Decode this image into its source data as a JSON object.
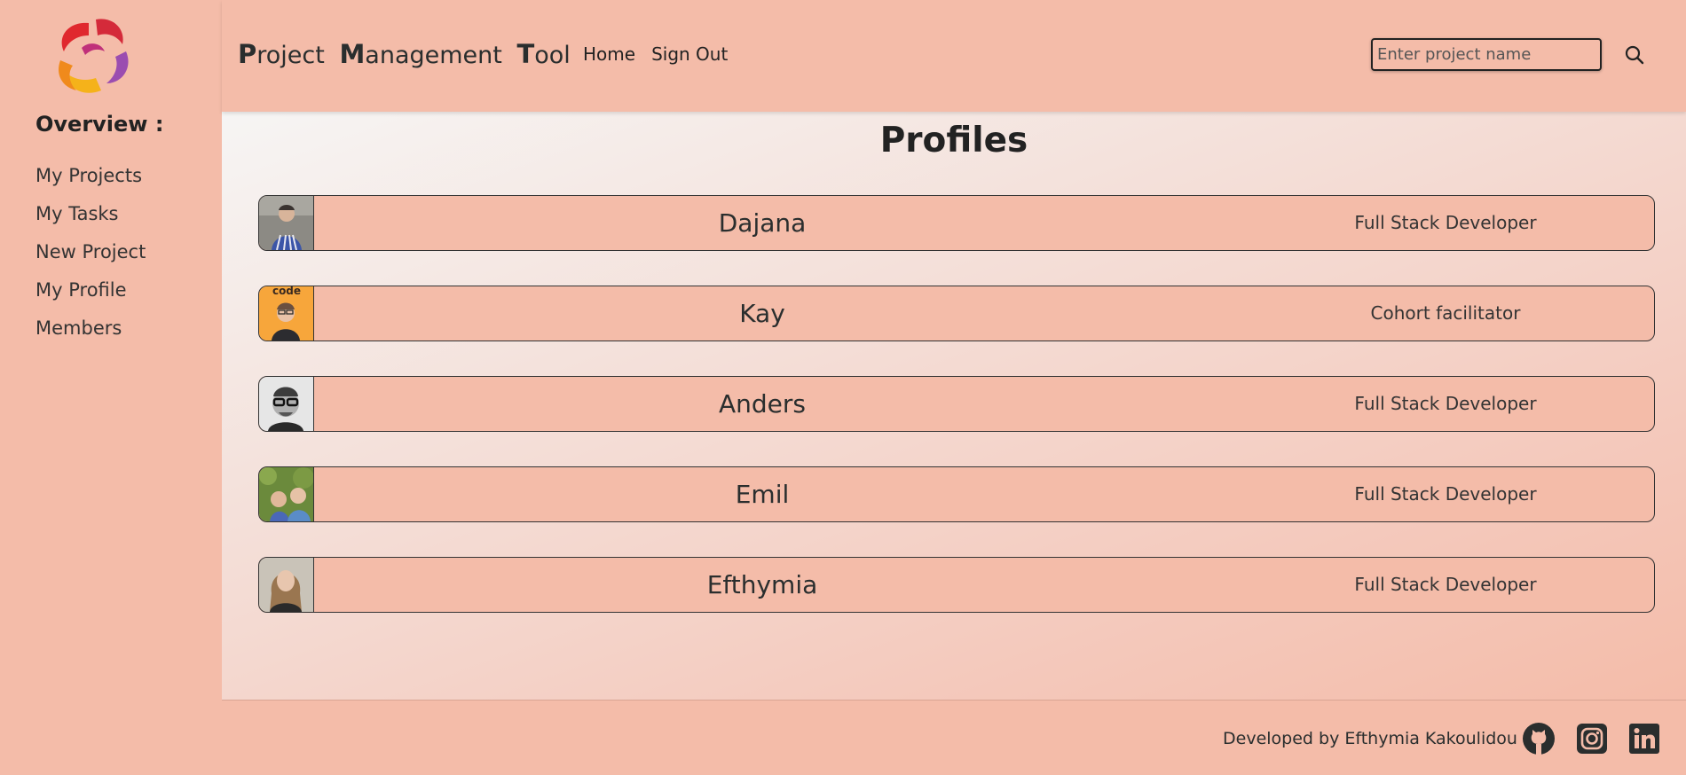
{
  "brand": {
    "logo_icon": "swirl-logo-icon",
    "title_words": [
      "Project",
      "Management",
      "Tool"
    ]
  },
  "sidebar": {
    "title": "Overview :",
    "items": [
      {
        "label": "My Projects"
      },
      {
        "label": "My Tasks"
      },
      {
        "label": "New Project"
      },
      {
        "label": "My Profile"
      },
      {
        "label": "Members"
      }
    ]
  },
  "header": {
    "nav": [
      {
        "label": "Home"
      },
      {
        "label": "Sign Out"
      }
    ],
    "search": {
      "placeholder": "Enter project name",
      "value": "",
      "icon": "search-icon"
    }
  },
  "main": {
    "title": "Profiles",
    "profiles": [
      {
        "name": "Dajana",
        "role": "Full Stack Developer",
        "avatar_icon": "avatar-photo-icon"
      },
      {
        "name": "Kay",
        "role": "Cohort facilitator",
        "avatar_icon": "avatar-photo-icon",
        "avatar_text": "code"
      },
      {
        "name": "Anders",
        "role": "Full Stack Developer",
        "avatar_icon": "avatar-photo-icon"
      },
      {
        "name": "Emil",
        "role": "Full Stack Developer",
        "avatar_icon": "avatar-photo-icon"
      },
      {
        "name": "Efthymia",
        "role": "Full Stack Developer",
        "avatar_icon": "avatar-photo-icon"
      }
    ]
  },
  "footer": {
    "text": "Developed by Efthymia Kakoulidou",
    "social": [
      {
        "icon": "github-icon"
      },
      {
        "icon": "instagram-icon"
      },
      {
        "icon": "linkedin-icon"
      }
    ]
  },
  "colors": {
    "background": "#F4BCA9",
    "text": "#2a2e2e",
    "border": "#333333"
  }
}
